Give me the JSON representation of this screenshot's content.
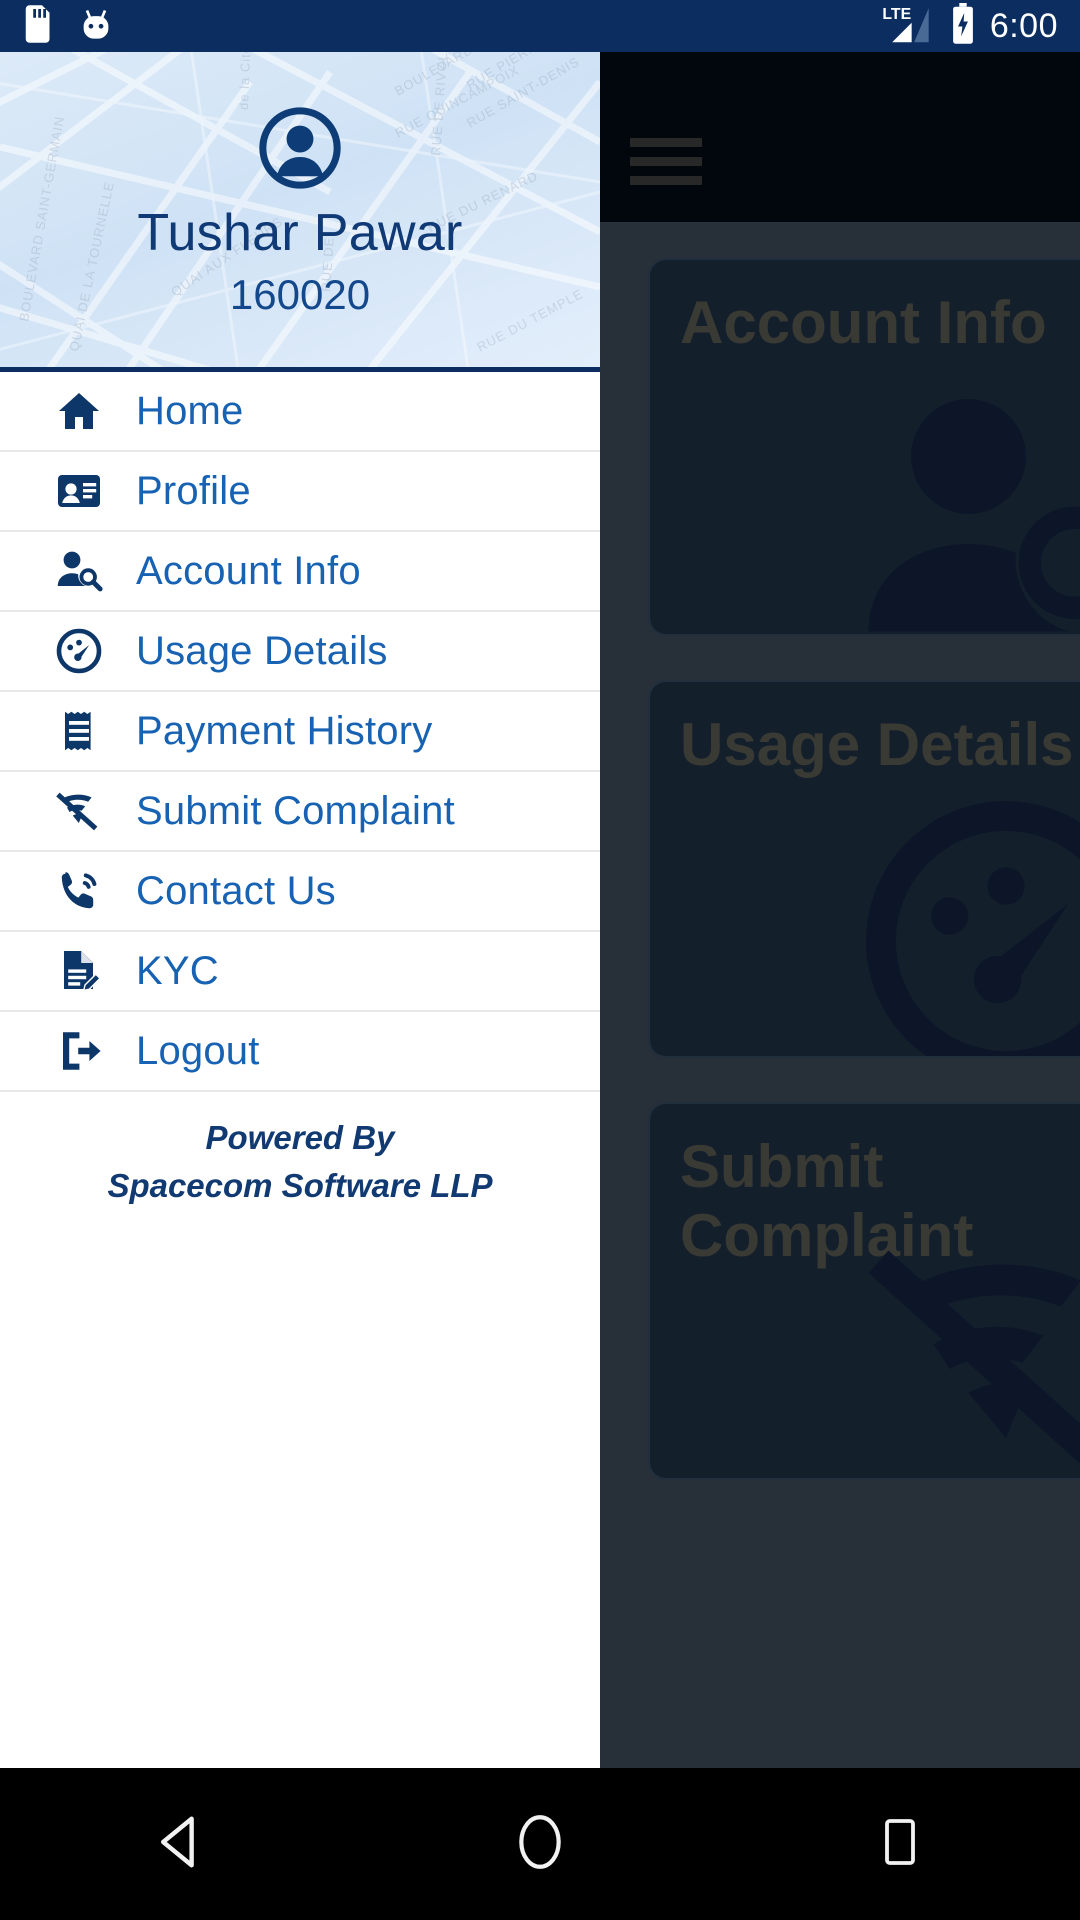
{
  "status_bar": {
    "time": "6:00",
    "icons": [
      "sd-card-icon",
      "android-marshmallow-icon",
      "lte-signal-icon",
      "battery-charging-icon"
    ],
    "network_label": "LTE",
    "background_color": "#0b2d60"
  },
  "background_app": {
    "appbar": {
      "menu_icon": "hamburger-menu-icon"
    },
    "cards": [
      {
        "title": "Account Info",
        "icon": "person-search-icon"
      },
      {
        "title": "Usage Details",
        "icon": "speedometer-icon"
      },
      {
        "title": "Submit Complaint",
        "icon": "wifi-off-icon"
      }
    ]
  },
  "drawer": {
    "header": {
      "avatar_icon": "user-avatar-icon",
      "name": "Tushar Pawar",
      "account_id": "160020"
    },
    "items": [
      {
        "label": "Home",
        "icon": "home-icon"
      },
      {
        "label": "Profile",
        "icon": "contact-card-icon"
      },
      {
        "label": "Account Info",
        "icon": "person-search-icon"
      },
      {
        "label": "Usage Details",
        "icon": "speedometer-icon"
      },
      {
        "label": "Payment History",
        "icon": "receipt-icon"
      },
      {
        "label": "Submit Complaint",
        "icon": "wifi-off-icon"
      },
      {
        "label": "Contact Us",
        "icon": "phone-in-talk-icon"
      },
      {
        "label": "KYC",
        "icon": "document-edit-icon"
      },
      {
        "label": "Logout",
        "icon": "logout-icon"
      }
    ],
    "footer": {
      "line1": "Powered By",
      "line2": "Spacecom Software LLP"
    },
    "accent_color": "#1762b3",
    "icon_color": "#0e3769"
  },
  "nav_bar": {
    "buttons": [
      {
        "name": "back-button",
        "icon": "triangle-left-icon"
      },
      {
        "name": "home-button",
        "icon": "circle-icon"
      },
      {
        "name": "recents-button",
        "icon": "square-icon"
      }
    ]
  }
}
